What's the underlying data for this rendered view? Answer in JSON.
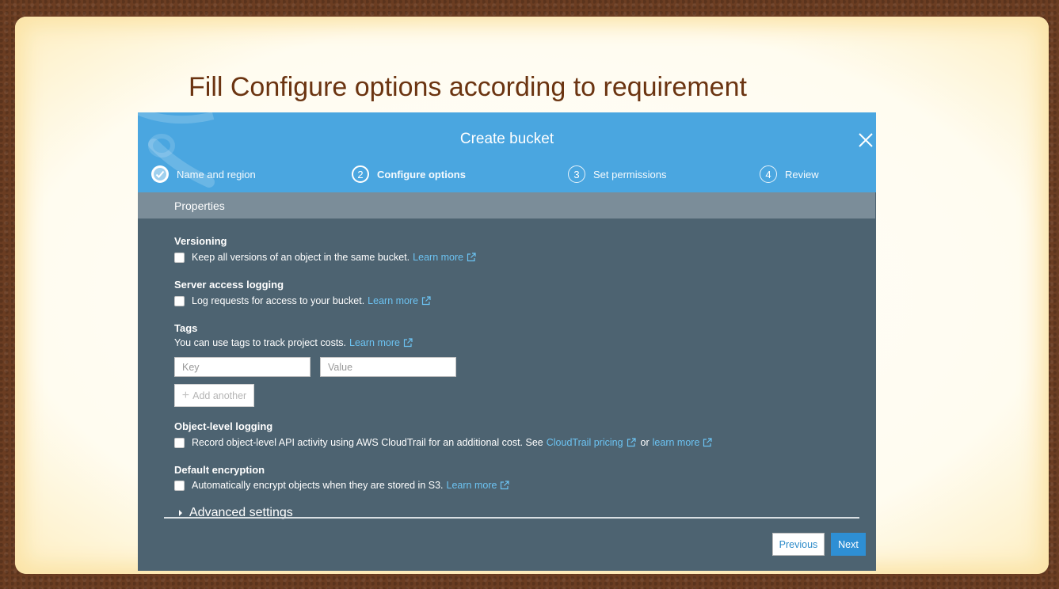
{
  "slide": {
    "title": "Fill Configure options according to requirement"
  },
  "dialog": {
    "title": "Create bucket",
    "steps": [
      {
        "number": "",
        "label": "Name and region",
        "state": "completed"
      },
      {
        "number": "2",
        "label": "Configure options",
        "state": "active"
      },
      {
        "number": "3",
        "label": "Set permissions",
        "state": "pending"
      },
      {
        "number": "4",
        "label": "Review",
        "state": "pending"
      }
    ],
    "properties_header": "Properties",
    "versioning": {
      "title": "Versioning",
      "text": "Keep all versions of an object in the same bucket.",
      "link": "Learn more",
      "checked": false
    },
    "server_access_logging": {
      "title": "Server access logging",
      "text": "Log requests for access to your bucket.",
      "link": "Learn more",
      "checked": false
    },
    "tags": {
      "title": "Tags",
      "text": "You can use tags to track project costs.",
      "link": "Learn more",
      "key_placeholder": "Key",
      "value_placeholder": "Value",
      "add_label": "Add another"
    },
    "object_level_logging": {
      "title": "Object-level logging",
      "text": "Record object-level API activity using AWS CloudTrail for an additional cost. See",
      "link1": "CloudTrail pricing",
      "or": "or",
      "link2": "learn more",
      "checked": false
    },
    "default_encryption": {
      "title": "Default encryption",
      "text": "Automatically encrypt objects when they are stored in S3.",
      "link": "Learn more",
      "checked": false
    },
    "advanced_settings": "Advanced settings",
    "previous_label": "Previous",
    "next_label": "Next"
  },
  "colors": {
    "header": "#4aa6e0",
    "body": "#4d6371",
    "properties_bar": "#7b8d99",
    "link": "#6cc3f2",
    "next_button": "#2e8fd4",
    "slide_title": "#6b3411"
  }
}
